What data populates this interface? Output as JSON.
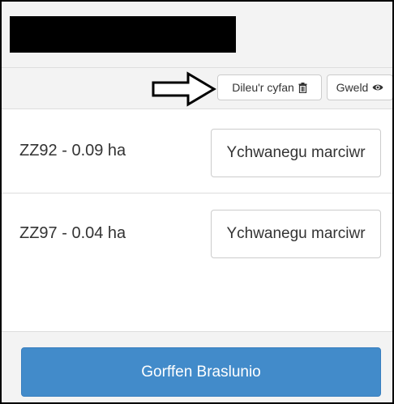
{
  "toolbar": {
    "delete_all_label": "Dileu'r cyfan",
    "delete_all_icon": "trash-icon",
    "view_label": "Gweld",
    "view_icon": "eye-icon"
  },
  "parcels": [
    {
      "label": "ZZ92 - 0.09 ha",
      "button_label": "Ychwanegu marciwr"
    },
    {
      "label": "ZZ97 - 0.04 ha",
      "button_label": "Ychwanegu marciwr"
    }
  ],
  "footer": {
    "finish_label": "Gorffen Braslunio",
    "finish_color": "#428bca"
  },
  "annotation": {
    "icon": "arrow-right-outline-icon"
  }
}
